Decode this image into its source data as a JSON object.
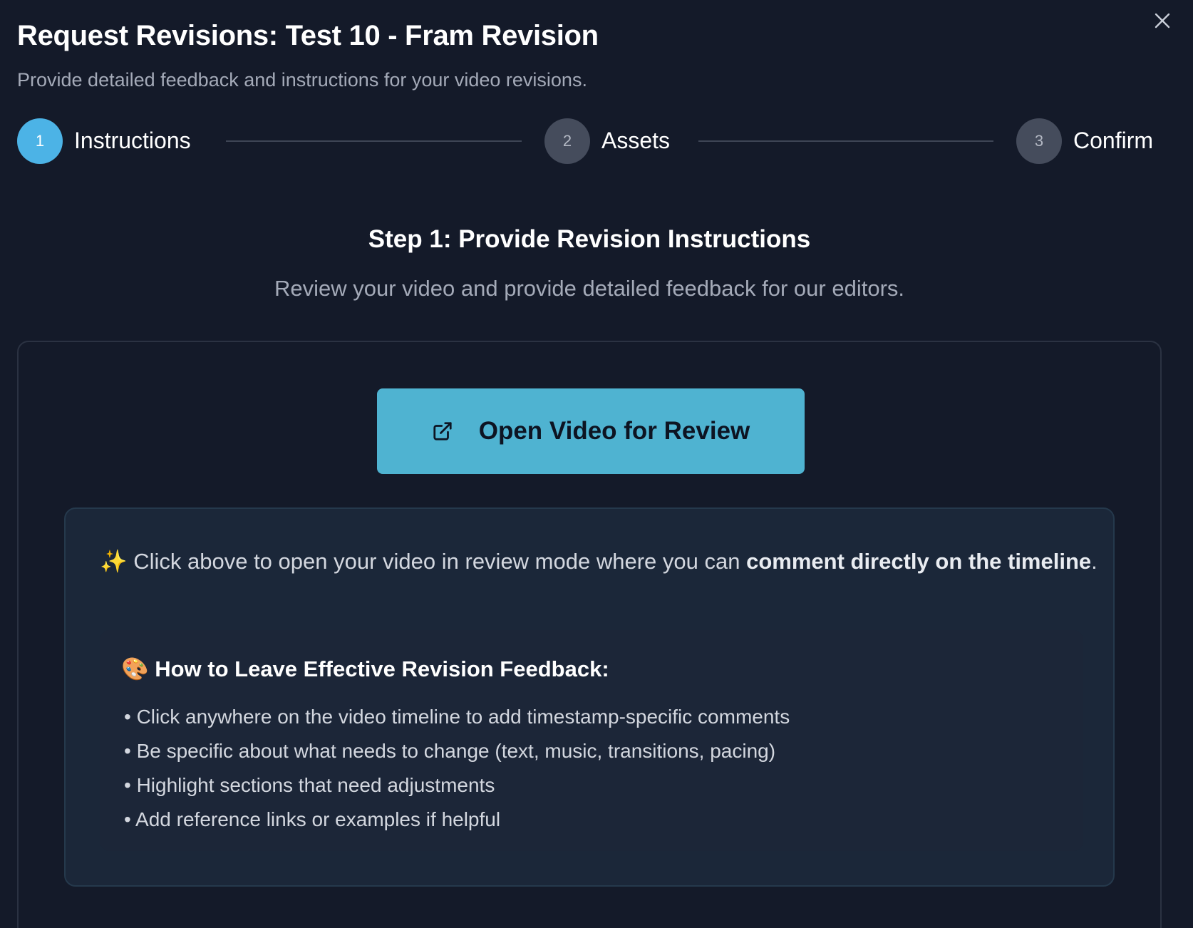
{
  "modal": {
    "title": "Request Revisions: Test 10 - Fram Revision",
    "subtitle": "Provide detailed feedback and instructions for your video revisions.",
    "close_icon": "close-icon"
  },
  "stepper": {
    "steps": [
      {
        "number": "1",
        "label": "Instructions",
        "state": "active"
      },
      {
        "number": "2",
        "label": "Assets",
        "state": "inactive"
      },
      {
        "number": "3",
        "label": "Confirm",
        "state": "inactive"
      }
    ]
  },
  "step1": {
    "heading": "Step 1: Provide Revision Instructions",
    "description": "Review your video and provide detailed feedback for our editors.",
    "open_button": {
      "label": "Open Video for Review",
      "icon": "external-link-icon"
    },
    "info": {
      "emoji": "✨",
      "text_before": " Click above to open your video in review mode where you can ",
      "text_bold": "comment directly on the timeline",
      "text_after": "."
    },
    "tips": {
      "emoji": "🎨",
      "title": " How to Leave Effective Revision Feedback:",
      "items": [
        "• Click anywhere on the video timeline to add timestamp-specific comments",
        "• Be specific about what needs to change (text, music, transitions, pacing)",
        "• Highlight sections that need adjustments",
        "• Add reference links or examples if helpful"
      ]
    }
  },
  "colors": {
    "background": "#141a29",
    "accent": "#4cb3e6",
    "button": "#4fb3d1",
    "muted_text": "#a4aab8"
  }
}
